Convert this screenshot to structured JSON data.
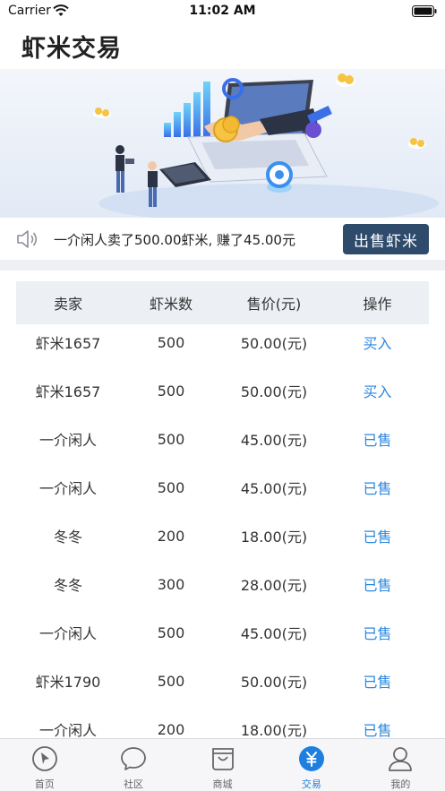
{
  "status_bar": {
    "carrier": "Carrier",
    "time": "11:02 AM"
  },
  "page": {
    "title": "虾米交易"
  },
  "notice": {
    "text": "一介闲人卖了500.00虾米, 赚了45.00元",
    "sell_button_label": "出售虾米"
  },
  "table": {
    "headers": [
      "卖家",
      "虾米数",
      "售价(元)",
      "操作"
    ],
    "rows": [
      {
        "seller": "虾米1657",
        "amount": "500",
        "price": "50.00(元)",
        "action": "买入"
      },
      {
        "seller": "虾米1657",
        "amount": "500",
        "price": "50.00(元)",
        "action": "买入"
      },
      {
        "seller": "一介闲人",
        "amount": "500",
        "price": "45.00(元)",
        "action": "已售"
      },
      {
        "seller": "一介闲人",
        "amount": "500",
        "price": "45.00(元)",
        "action": "已售"
      },
      {
        "seller": "冬冬",
        "amount": "200",
        "price": "18.00(元)",
        "action": "已售"
      },
      {
        "seller": "冬冬",
        "amount": "300",
        "price": "28.00(元)",
        "action": "已售"
      },
      {
        "seller": "一介闲人",
        "amount": "500",
        "price": "45.00(元)",
        "action": "已售"
      },
      {
        "seller": "虾米1790",
        "amount": "500",
        "price": "50.00(元)",
        "action": "已售"
      },
      {
        "seller": "一介闲人",
        "amount": "200",
        "price": "18.00(元)",
        "action": "已售"
      }
    ]
  },
  "tab_bar": {
    "tabs": [
      {
        "label": "首页",
        "icon": "compass-icon"
      },
      {
        "label": "社区",
        "icon": "chat-icon"
      },
      {
        "label": "商城",
        "icon": "shopping-bag-icon"
      },
      {
        "label": "交易",
        "icon": "yuan-icon",
        "active": true
      },
      {
        "label": "我的",
        "icon": "user-icon"
      }
    ]
  },
  "colors": {
    "accent": "#1e7fe0",
    "sell_button": "#2f4b6b",
    "action_link": "#2a87e0"
  }
}
